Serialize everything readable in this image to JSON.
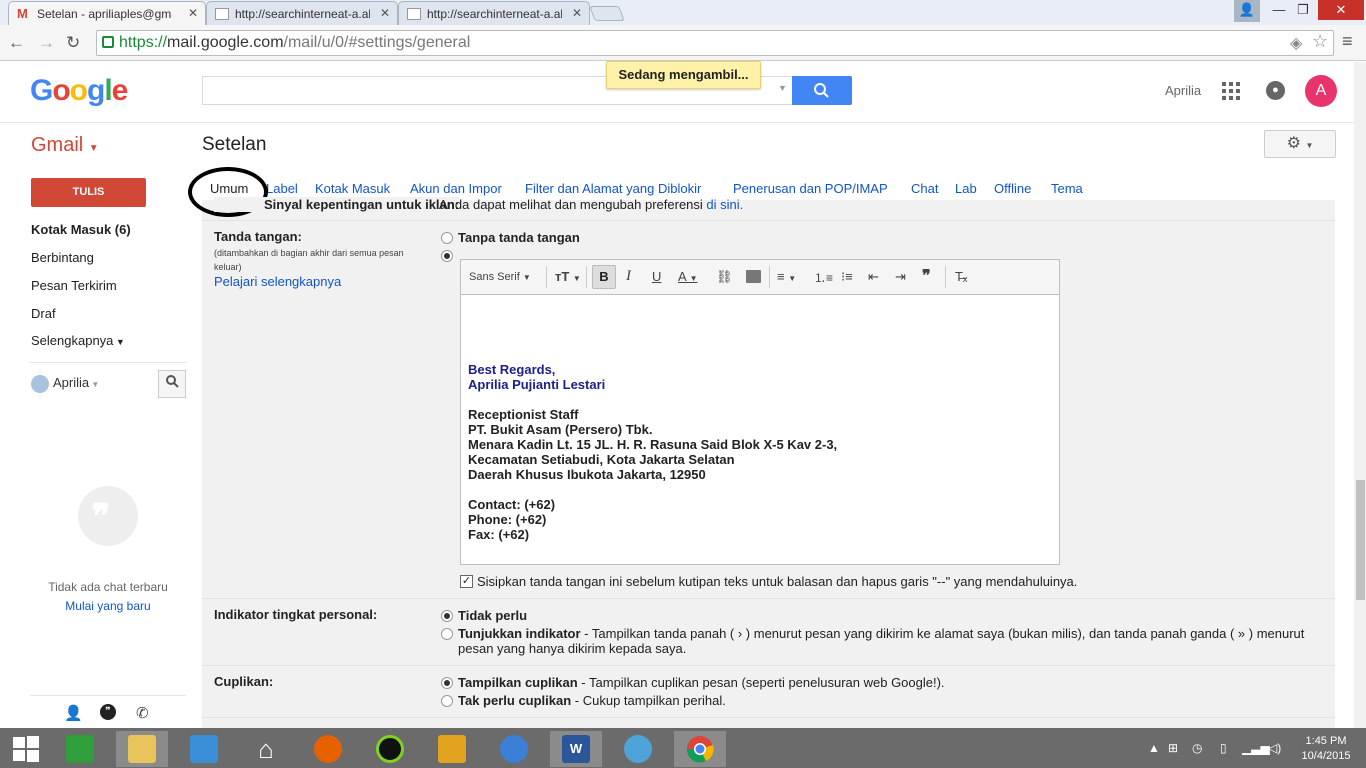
{
  "browser": {
    "tabs": [
      {
        "title": "Setelan - apriliaples@gma"
      },
      {
        "title": "http://searchinterneat-a.al"
      },
      {
        "title": "http://searchinterneat-a.al"
      }
    ],
    "url_scheme": "https://",
    "url_host": "mail.google.com",
    "url_path": "/mail/u/0/#settings/general"
  },
  "header": {
    "logo": "Google",
    "loading": "Sedang mengambil...",
    "user_name": "Aprilia",
    "avatar_letter": "A",
    "brand": "Gmail",
    "page_title": "Setelan"
  },
  "nav": {
    "compose": "TULIS",
    "items": [
      "Kotak Masuk (6)",
      "Berbintang",
      "Pesan Terkirim",
      "Draf",
      "Selengkapnya"
    ],
    "chat_user": "Aprilia",
    "no_chats": "Tidak ada chat terbaru",
    "start_new": "Mulai yang baru"
  },
  "settings_tabs": [
    "Umum",
    "Label",
    "Kotak Masuk",
    "Akun dan Impor",
    "Filter dan Alamat yang Diblokir",
    "Penerusan dan POP/IMAP",
    "Chat",
    "Lab",
    "Offline",
    "Tema"
  ],
  "ads": {
    "label": "Sinyal kepentingan untuk iklan:",
    "text": "Anda dapat melihat dan mengubah preferensi",
    "link": "di sini."
  },
  "signature": {
    "label": "Tanda tangan:",
    "note": "(ditambahkan di bagian akhir dari semua pesan keluar)",
    "learn_more": "Pelajari selengkapnya",
    "none_option": "Tanpa tanda tangan",
    "font": "Sans Serif",
    "lines": [
      "Best Regards,",
      "Aprilia Pujianti Lestari",
      "",
      "Receptionist Staff",
      "PT. Bukit Asam (Persero) Tbk.",
      "Menara Kadin Lt. 15 JL. H. R. Rasuna Said Blok X-5 Kav 2-3,",
      "Kecamatan Setiabudi, Kota Jakarta Selatan",
      "Daerah Khusus Ibukota Jakarta, 12950",
      "",
      "Contact: (+62)",
      "Phone: (+62)",
      "Fax: (+62)"
    ],
    "insert_before_quote": "Sisipkan tanda tangan ini sebelum kutipan teks untuk balasan dan hapus garis \"--\" yang mendahuluinya."
  },
  "personal_indicator": {
    "label": "Indikator tingkat personal:",
    "opt1": "Tidak perlu",
    "opt2_bold": "Tunjukkan indikator",
    "opt2_text": " - Tampilkan tanda panah ( › ) menurut pesan yang dikirim ke alamat saya (bukan milis), dan tanda panah ganda ( » ) menurut",
    "opt2_text2": "pesan yang hanya dikirim kepada saya."
  },
  "snippets": {
    "label": "Cuplikan:",
    "opt1_bold": "Tampilkan cuplikan",
    "opt1_text": " - Tampilkan cuplikan pesan (seperti penelusuran web Google!).",
    "opt2_bold": "Tak perlu cuplikan",
    "opt2_text": " - Cukup tampilkan perihal."
  },
  "taskbar": {
    "time": "1:45 PM",
    "date": "10/4/2015"
  }
}
